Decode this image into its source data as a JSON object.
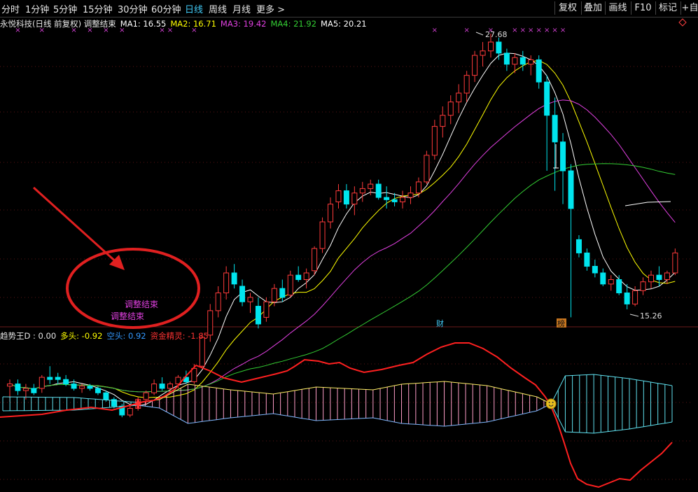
{
  "periods": [
    "分时",
    "1分钟",
    "5分钟",
    "15分钟",
    "30分钟",
    "60分钟",
    "日线",
    "周线",
    "月线",
    "更多 >"
  ],
  "active_period": "日线",
  "tools": [
    "复权",
    "叠加",
    "画线",
    "F10",
    "标记",
    "+自"
  ],
  "stock_title": "永悦科技(日线 前复权) 调整结束",
  "ma": [
    {
      "label": "MA1: 16.55",
      "color": "#ffffff"
    },
    {
      "label": "MA2: 16.71",
      "color": "#ffff00"
    },
    {
      "label": "MA3: 19.42",
      "color": "#e040e0"
    },
    {
      "label": "MA4: 21.92",
      "color": "#33cc33"
    },
    {
      "label": "MA5: 20.21",
      "color": "#ffffff"
    }
  ],
  "high_label": "27.68",
  "low_label": "15.26",
  "annotations": {
    "adjust_1": "调整结束",
    "adjust_2": "调整结束",
    "cai_badge": "财",
    "bang_badge": "榜"
  },
  "indicator": {
    "name": "趋势王D : 0.00",
    "items": [
      {
        "label": "多头: -0.92",
        "color": "#ffff00"
      },
      {
        "label": "空头: 0.92",
        "color": "#3399ff"
      },
      {
        "label": "资金精灵: -1.85",
        "color": "#ff3333"
      }
    ]
  },
  "colors": {
    "up": "#ff3b3b",
    "down": "#00e5ee",
    "ma1": "#ffffff",
    "ma2": "#ffff00",
    "ma3": "#e040e0",
    "ma4": "#33cc33",
    "ma5": "#ffffff",
    "bull_fill": "#ff9ec8",
    "bear_fill": "#5fe0ee",
    "money": "#ff2020",
    "marker": "#d040d0"
  },
  "chart_data": {
    "type": "candlestick",
    "candles": [
      [
        11.8,
        12.1,
        11.1,
        11.9
      ],
      [
        11.9,
        12.1,
        11.4,
        11.6
      ],
      [
        11.6,
        11.9,
        11.2,
        11.7
      ],
      [
        11.7,
        11.9,
        11.4,
        11.5
      ],
      [
        11.7,
        12.3,
        11.5,
        12.2
      ],
      [
        12.2,
        12.7,
        11.9,
        12.1
      ],
      [
        12.2,
        12.4,
        11.9,
        12.1
      ],
      [
        12.1,
        12.3,
        11.8,
        11.9
      ],
      [
        11.9,
        12.1,
        11.6,
        11.7
      ],
      [
        11.7,
        11.9,
        11.5,
        11.8
      ],
      [
        11.8,
        11.9,
        11.6,
        11.7
      ],
      [
        11.7,
        11.8,
        11.4,
        11.5
      ],
      [
        11.5,
        11.6,
        11.1,
        11.2
      ],
      [
        11.2,
        11.3,
        10.8,
        10.9
      ],
      [
        10.9,
        11.0,
        10.4,
        10.5
      ],
      [
        10.5,
        10.9,
        10.4,
        10.8
      ],
      [
        10.8,
        11.3,
        10.7,
        11.2
      ],
      [
        11.2,
        11.6,
        11.0,
        11.5
      ],
      [
        11.5,
        12.1,
        11.4,
        11.9
      ],
      [
        11.9,
        12.2,
        11.6,
        11.7
      ],
      [
        11.7,
        12.0,
        11.5,
        11.9
      ],
      [
        11.9,
        12.3,
        11.7,
        12.2
      ],
      [
        12.2,
        12.5,
        11.9,
        12.0
      ],
      [
        12.0,
        12.8,
        11.9,
        12.6
      ],
      [
        12.7,
        14.2,
        12.6,
        14.0
      ],
      [
        14.1,
        15.5,
        13.8,
        15.2
      ],
      [
        15.2,
        16.3,
        14.9,
        16.0
      ],
      [
        16.0,
        17.2,
        15.7,
        16.9
      ],
      [
        16.9,
        17.3,
        16.2,
        16.4
      ],
      [
        16.3,
        16.6,
        15.4,
        15.6
      ],
      [
        15.6,
        16.0,
        15.1,
        15.8
      ],
      [
        15.4,
        15.8,
        14.4,
        14.6
      ],
      [
        14.9,
        15.8,
        14.7,
        15.6
      ],
      [
        15.6,
        16.4,
        15.4,
        16.2
      ],
      [
        16.2,
        16.6,
        15.6,
        15.8
      ],
      [
        15.9,
        17.0,
        15.8,
        16.8
      ],
      [
        16.8,
        17.2,
        16.5,
        16.6
      ],
      [
        16.6,
        17.1,
        16.2,
        16.9
      ],
      [
        17.0,
        18.1,
        16.8,
        18.0
      ],
      [
        18.0,
        19.4,
        17.8,
        19.2
      ],
      [
        19.2,
        20.3,
        18.9,
        20.0
      ],
      [
        20.1,
        20.9,
        19.8,
        20.6
      ],
      [
        20.6,
        20.9,
        19.8,
        20.0
      ],
      [
        20.0,
        20.8,
        19.5,
        20.5
      ],
      [
        20.5,
        21.0,
        20.1,
        20.7
      ],
      [
        20.7,
        21.1,
        20.4,
        20.9
      ],
      [
        20.9,
        21.1,
        20.2,
        20.3
      ],
      [
        20.3,
        20.8,
        19.8,
        20.2
      ],
      [
        20.2,
        20.5,
        19.9,
        20.1
      ],
      [
        20.1,
        20.6,
        19.8,
        20.3
      ],
      [
        20.3,
        20.8,
        20.0,
        20.5
      ],
      [
        20.5,
        21.2,
        20.3,
        21.0
      ],
      [
        21.0,
        22.4,
        20.9,
        22.2
      ],
      [
        22.2,
        23.8,
        22.0,
        23.5
      ],
      [
        23.5,
        24.4,
        23.0,
        24.0
      ],
      [
        24.0,
        24.9,
        23.6,
        24.6
      ],
      [
        24.6,
        25.4,
        24.1,
        25.0
      ],
      [
        25.0,
        26.0,
        24.6,
        25.8
      ],
      [
        25.8,
        26.9,
        25.5,
        26.7
      ],
      [
        26.7,
        27.3,
        26.2,
        26.9
      ],
      [
        26.9,
        27.68,
        26.6,
        27.3
      ],
      [
        27.3,
        27.5,
        26.5,
        26.8
      ],
      [
        26.8,
        27.0,
        26.0,
        26.3
      ],
      [
        26.3,
        26.8,
        25.9,
        26.6
      ],
      [
        26.6,
        26.9,
        26.0,
        26.3
      ],
      [
        26.3,
        26.7,
        25.8,
        26.5
      ],
      [
        26.5,
        26.7,
        25.2,
        25.5
      ],
      [
        25.5,
        25.8,
        21.5,
        24.0
      ],
      [
        24.0,
        24.8,
        20.6,
        22.8
      ],
      [
        22.8,
        23.2,
        20.0,
        21.5
      ],
      [
        21.5,
        21.8,
        14.9,
        19.8
      ],
      [
        18.4,
        18.6,
        17.6,
        17.8
      ],
      [
        17.8,
        18.0,
        17.0,
        17.2
      ],
      [
        17.2,
        17.5,
        16.7,
        16.9
      ],
      [
        16.9,
        17.1,
        16.3,
        16.4
      ],
      [
        16.4,
        16.8,
        16.1,
        16.6
      ],
      [
        16.6,
        16.8,
        15.9,
        16.0
      ],
      [
        16.0,
        16.4,
        15.26,
        15.5
      ],
      [
        15.5,
        16.3,
        15.4,
        16.1
      ],
      [
        16.1,
        16.7,
        15.9,
        16.5
      ],
      [
        16.5,
        17.0,
        16.2,
        16.8
      ],
      [
        16.8,
        17.2,
        16.3,
        16.6
      ],
      [
        16.6,
        17.0,
        16.4,
        16.9
      ],
      [
        16.9,
        18.0,
        16.8,
        17.8
      ]
    ],
    "markers": [
      1,
      4,
      8,
      10,
      12,
      14,
      19,
      20,
      23,
      53,
      57,
      60,
      63,
      64,
      65,
      66,
      67,
      68,
      69
    ],
    "high": 27.68,
    "low": 15.26
  }
}
